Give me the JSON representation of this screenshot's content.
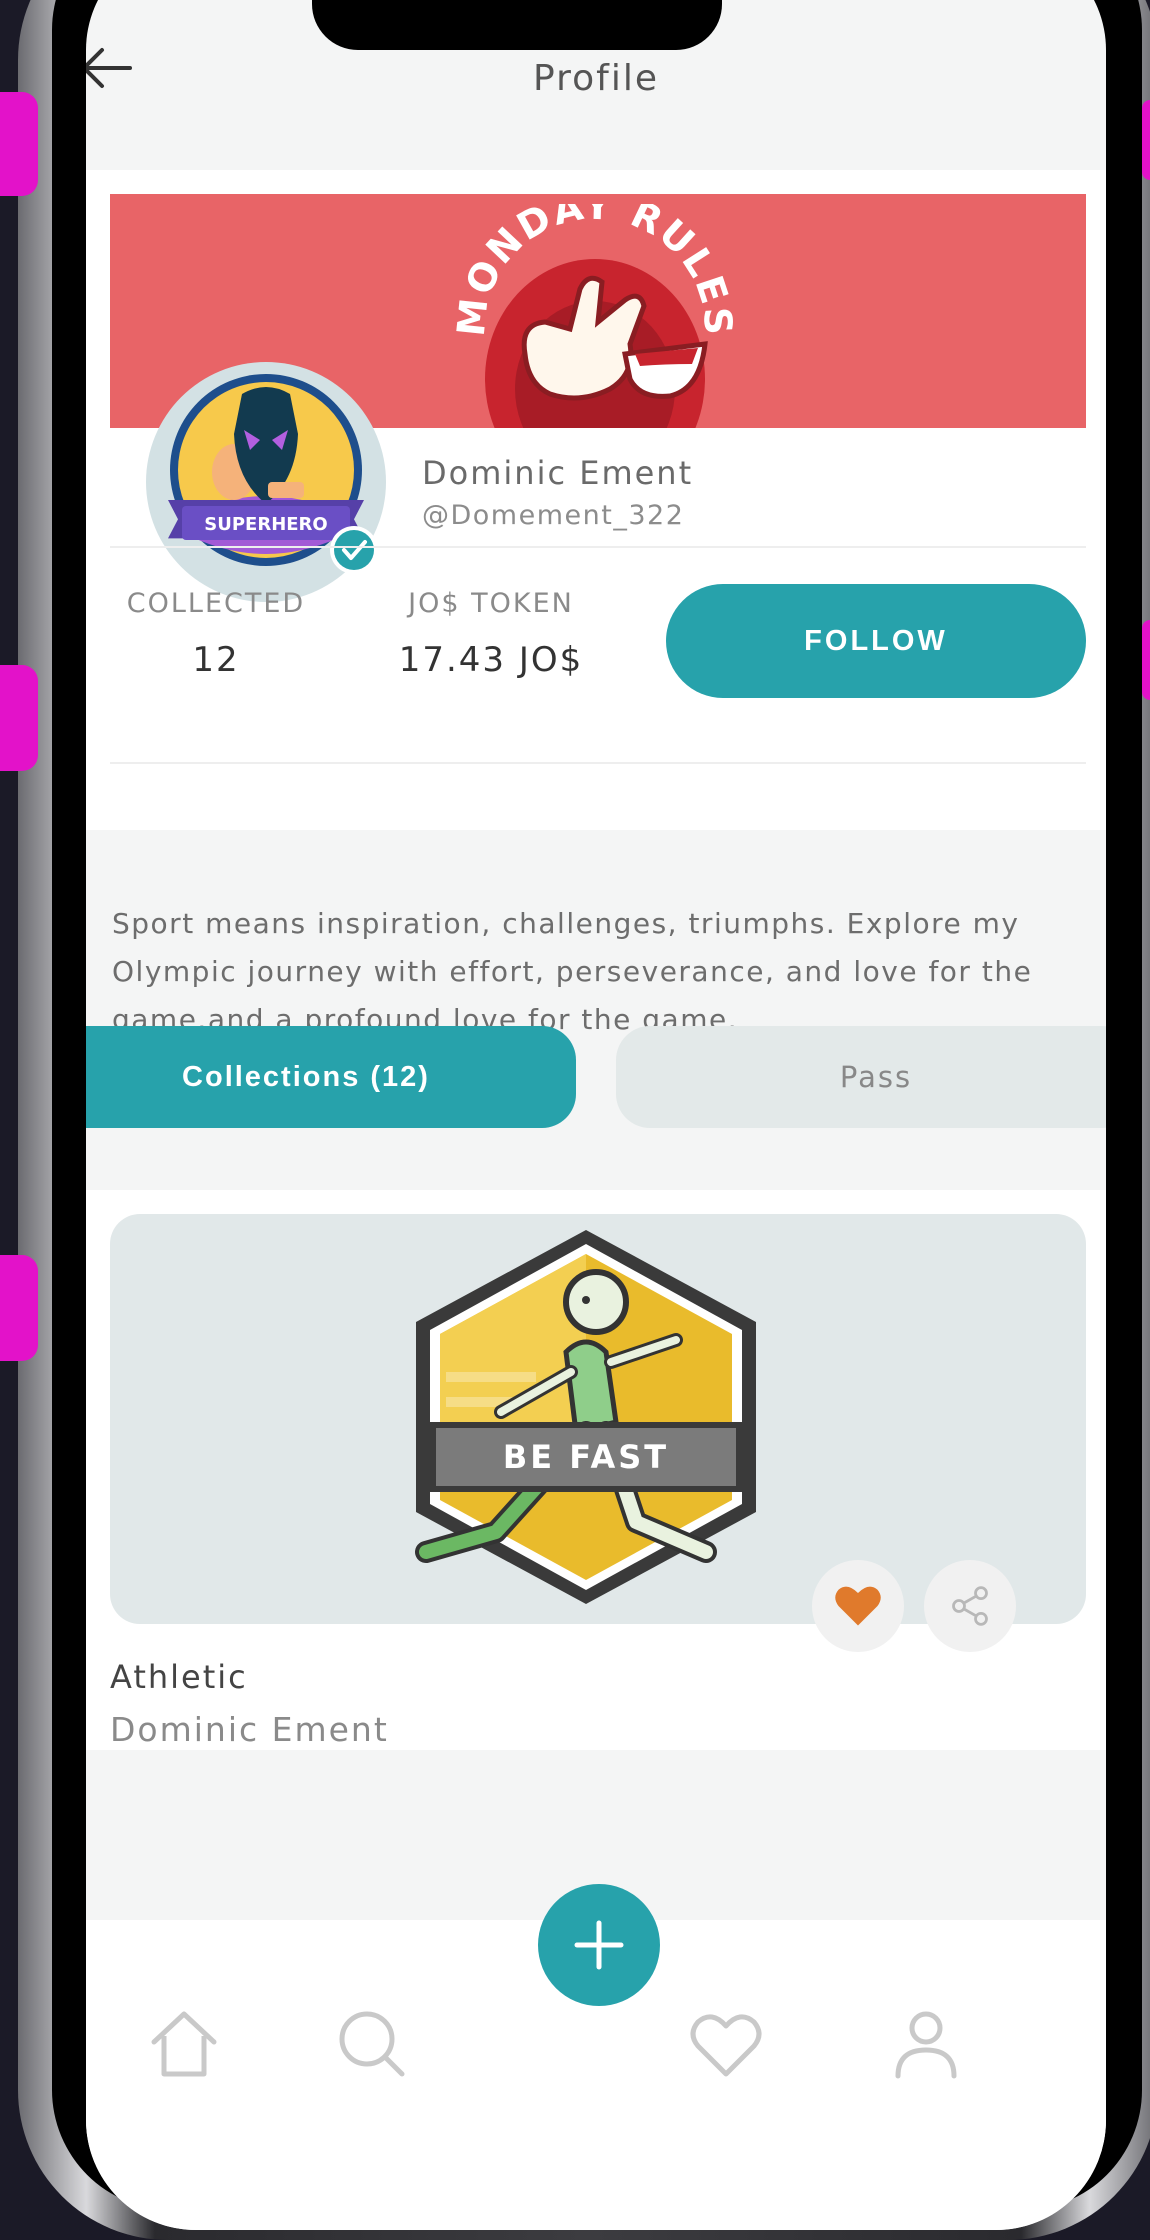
{
  "header": {
    "title": "Profile",
    "back_icon": "arrow-left-icon"
  },
  "banner": {
    "logo_text": "MONDAY RULES"
  },
  "profile": {
    "name": "Dominic Ement",
    "handle": "@Domement_322",
    "avatar_badge": "SUPERHERO",
    "verified_icon": "check-badge-icon"
  },
  "stats": {
    "collected_label": "COLLECTED",
    "collected_value": "12",
    "token_label": "JO$ TOKEN",
    "token_value": "17.43 JO$"
  },
  "follow_label": "FOLLOW",
  "bio": "Sport means inspiration, challenges, triumphs. Explore my Olympic journey with effort, perseverance, and love for the game.and a profound love for the game.",
  "tabs": [
    {
      "label": "Collections (12)",
      "active": true
    },
    {
      "label": "Pass",
      "active": false
    }
  ],
  "collection": {
    "title": "Athletic",
    "owner": "Dominic Ement",
    "badge_text": "BE FAST",
    "like_icon": "heart-icon",
    "share_icon": "share-icon"
  },
  "nav": {
    "items": [
      "home-icon",
      "search-icon",
      "add-icon",
      "heart-icon",
      "profile-icon"
    ]
  },
  "colors": {
    "accent": "#27a2ab",
    "banner": "#e86467",
    "like": "#e07a2c"
  }
}
